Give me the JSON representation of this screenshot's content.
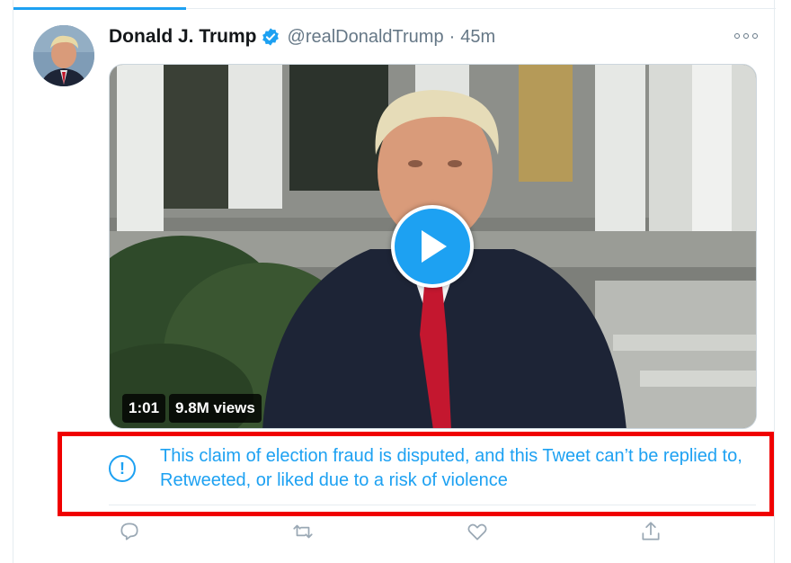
{
  "tweet": {
    "author_name": "Donald J. Trump",
    "handle": "@realDonaldTrump",
    "separator": "·",
    "time": "45m"
  },
  "media": {
    "duration": "1:01",
    "views": "9.8M views"
  },
  "notice": {
    "text": "This claim of election fraud is disputed, and this Tweet can’t be replied to, Retweeted, or liked due to a risk of violence"
  },
  "colors": {
    "accent": "#1da1f2",
    "highlight_border": "#f00000",
    "secondary_text": "#657786"
  },
  "icons": {
    "verified": "verified-badge-icon",
    "more": "more-options-icon",
    "play": "play-icon",
    "notice": "exclamation-circle-icon",
    "reply": "reply-icon",
    "retweet": "retweet-icon",
    "like": "like-icon",
    "share": "share-icon"
  }
}
